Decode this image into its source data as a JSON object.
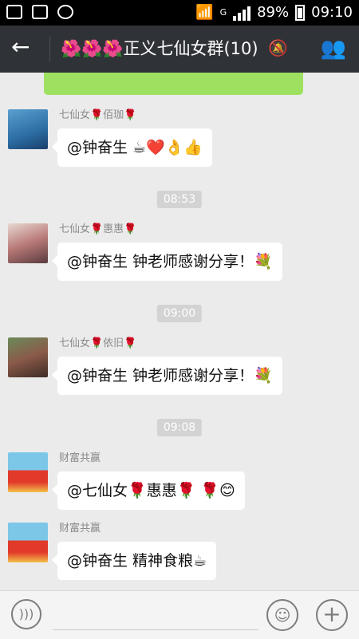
{
  "status_bar": {
    "network": "G",
    "battery_percent": "89%",
    "time": "09:10"
  },
  "header": {
    "title": "🌺🌺🌺正义七仙女群(10)",
    "back_icon": "arrow-left-icon",
    "mute_icon": "bell-muted-icon",
    "members_icon": "group-members-icon"
  },
  "messages": [
    {
      "sender": "七仙女🌹佰珈🌹",
      "text": "@钟奋生 ☕❤️👌👍"
    },
    {
      "sender": "七仙女🌹惠惠🌹",
      "text": "@钟奋生 钟老师感谢分享！💐"
    },
    {
      "sender": "七仙女🌹依旧🌹",
      "text": "@钟奋生 钟老师感谢分享！💐"
    },
    {
      "sender": "财富共赢",
      "text": "@七仙女🌹惠惠🌹 🌹😊"
    },
    {
      "sender": "财富共赢",
      "text": "@钟奋生 精神食粮☕"
    }
  ],
  "timestamps": [
    "08:53",
    "09:00",
    "09:08"
  ],
  "bottom_bar": {
    "voice_icon": "voice-icon",
    "emoji_icon": "emoji-icon",
    "plus_icon": "plus-icon"
  },
  "colors": {
    "header_bg": "#2f3236",
    "chat_bg": "#ebebeb",
    "self_bubble": "#9ee161"
  }
}
